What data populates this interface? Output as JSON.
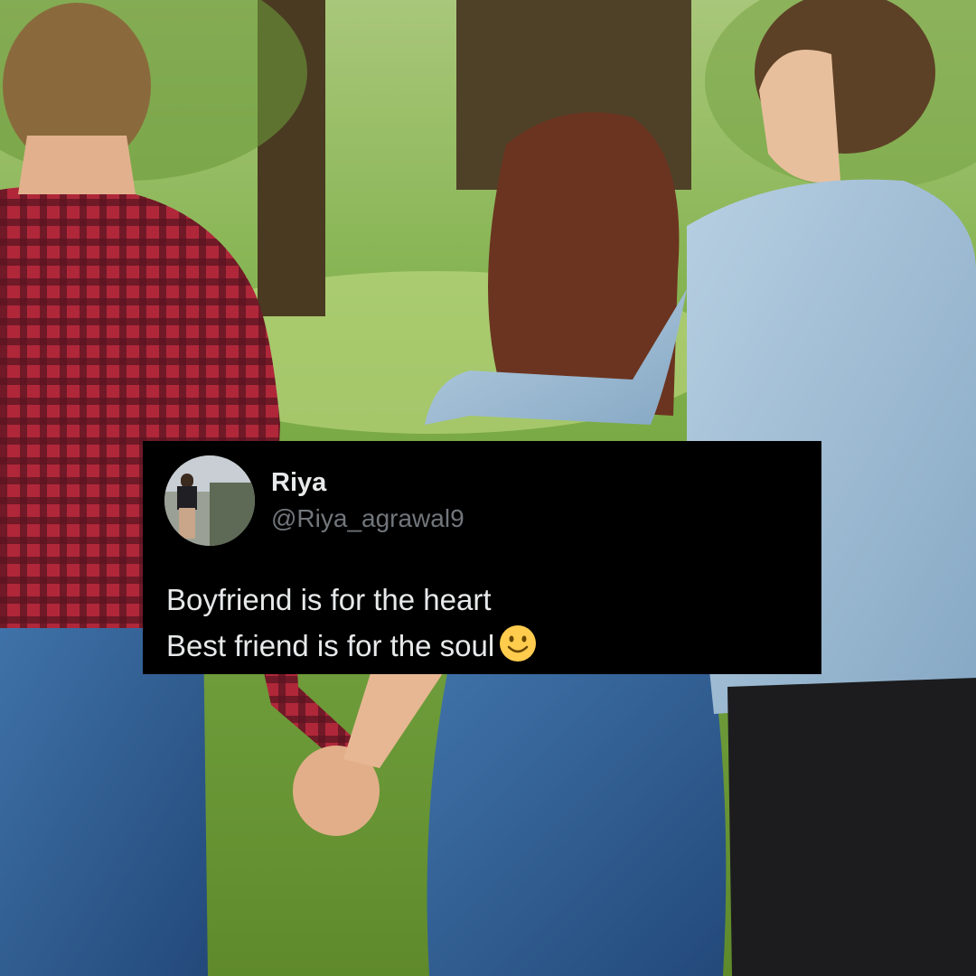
{
  "tweet": {
    "display_name": "Riya",
    "handle": "@Riya_agrawal9",
    "lines": [
      "Boyfriend is for the heart",
      "Best friend is for the soul"
    ],
    "emoji": "slightly-smiling-face-emoji"
  },
  "colors": {
    "card_background": "#000000",
    "name_text": "#e7e9ea",
    "handle_text": "#71767b",
    "grass": "#79a23c",
    "plaid_shirt": "#8e1f2b",
    "denim_jacket": "#9fbcd4",
    "jeans": "#2f5d91"
  }
}
